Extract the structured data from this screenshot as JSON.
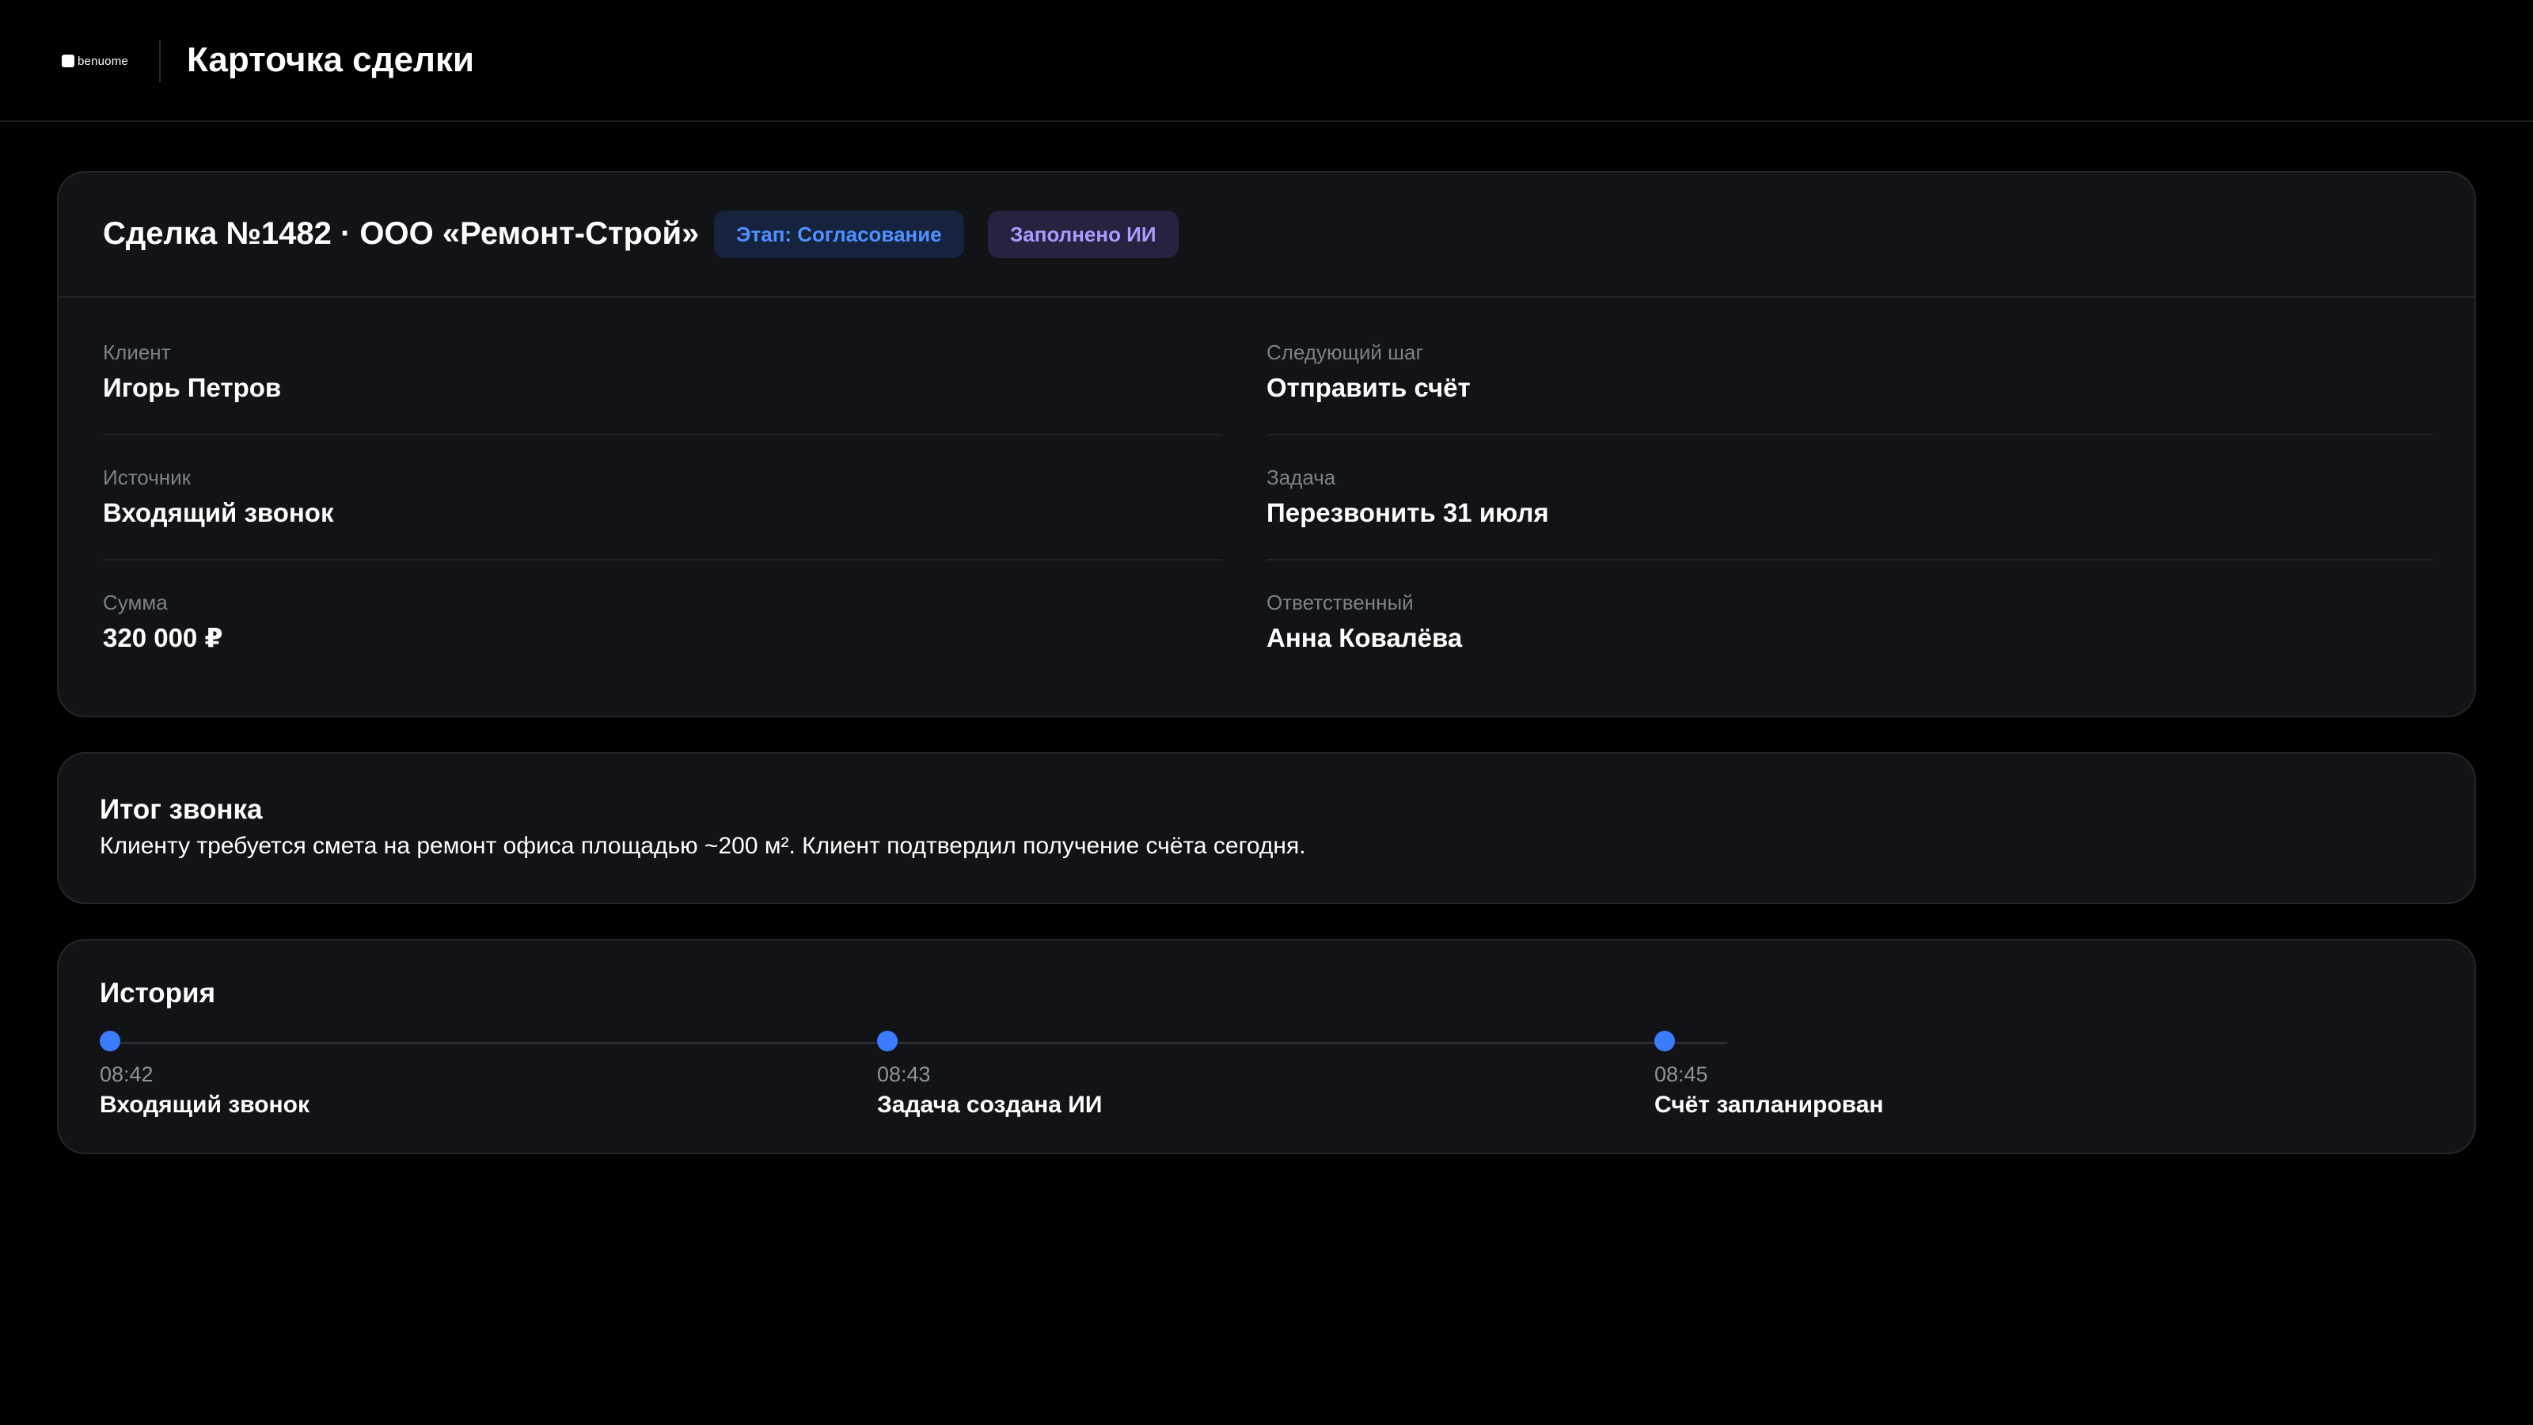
{
  "header": {
    "logo_text": "benuome",
    "title": "Карточка сделки"
  },
  "deal": {
    "title": "Сделка №1482 · ООО «Ремонт-Строй»",
    "stage_badge": "Этап: Согласование",
    "ai_badge": "Заполнено ИИ",
    "fields": {
      "client": {
        "label": "Клиент",
        "value": "Игорь Петров"
      },
      "next_step": {
        "label": "Следующий шаг",
        "value": "Отправить счёт"
      },
      "source": {
        "label": "Источник",
        "value": "Входящий звонок"
      },
      "task": {
        "label": "Задача",
        "value": "Перезвонить 31 июля"
      },
      "amount": {
        "label": "Сумма",
        "value": "320 000 ₽"
      },
      "owner": {
        "label": "Ответственный",
        "value": "Анна Ковалёва"
      }
    }
  },
  "summary": {
    "title": "Итог звонка",
    "text": "Клиенту требуется смета на ремонт офиса площадью ~200 м². Клиент подтвердил получение счёта сегодня."
  },
  "history": {
    "title": "История",
    "events": [
      {
        "time": "08:42",
        "label": "Входящий звонок"
      },
      {
        "time": "08:43",
        "label": "Задача создана ИИ"
      },
      {
        "time": "08:45",
        "label": "Счёт запланирован"
      }
    ]
  },
  "colors": {
    "accent": "#3b7cff",
    "stage_badge_text": "#4f8fff",
    "ai_badge_text": "#a99bff",
    "card_bg": "#121316"
  }
}
